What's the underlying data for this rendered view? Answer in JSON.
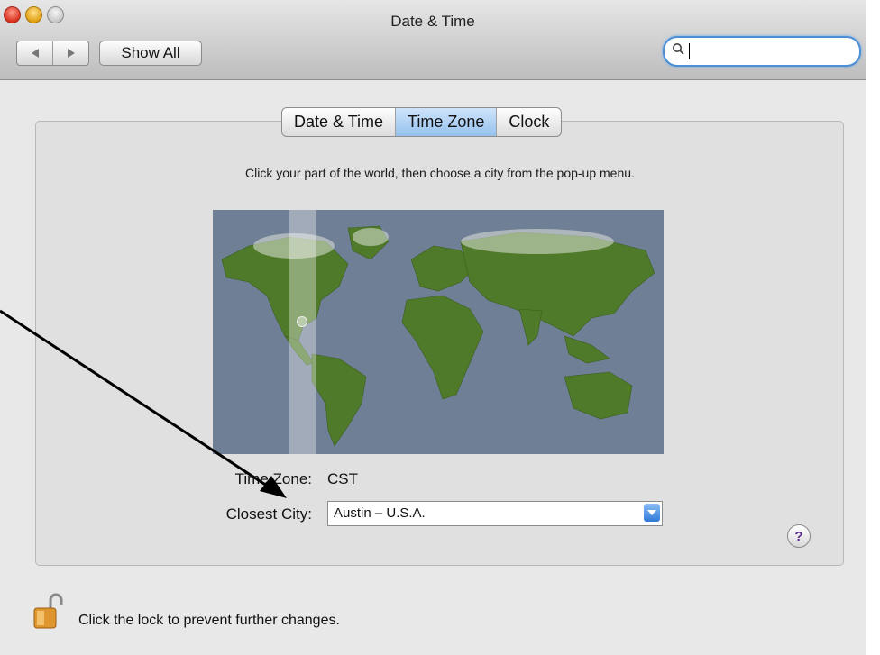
{
  "window": {
    "title": "Date & Time"
  },
  "toolbar": {
    "show_all_label": "Show All",
    "search_value": ""
  },
  "tabs": [
    {
      "label": "Date & Time",
      "active": false
    },
    {
      "label": "Time Zone",
      "active": true
    },
    {
      "label": "Clock",
      "active": false
    }
  ],
  "instructions": "Click your part of the world, then choose a city from the pop-up menu.",
  "time_zone": {
    "label": "Time Zone:",
    "value": "CST"
  },
  "closest_city": {
    "label": "Closest City:",
    "value": "Austin – U.S.A."
  },
  "footer": {
    "lock_text": "Click the lock to prevent further changes."
  },
  "colors": {
    "accent": "#5a9ce8",
    "active_tab": "#a9cdf3",
    "map_ocean": "#6f7f96",
    "land": "#4f7a2a"
  },
  "icons": [
    "back-arrow-icon",
    "forward-arrow-icon",
    "search-icon",
    "popup-arrow-icon",
    "help-icon",
    "lock-icon"
  ]
}
